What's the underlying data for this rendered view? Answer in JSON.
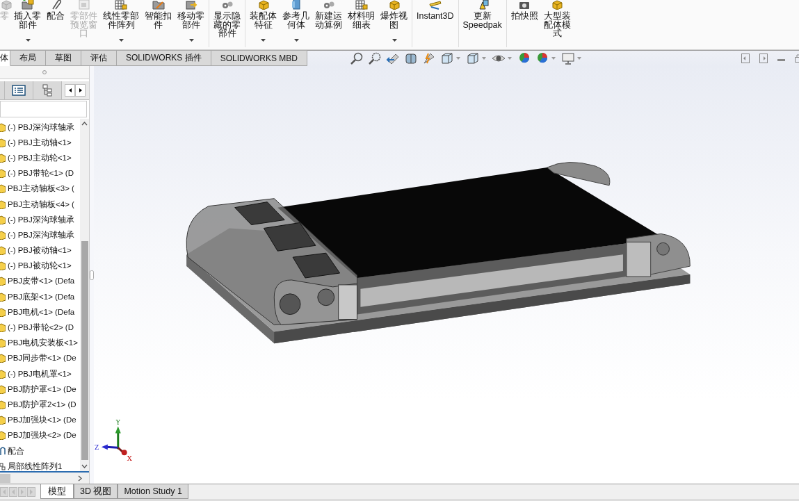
{
  "command_manager": {
    "buttons": [
      {
        "lines": [
          "零"
        ],
        "disabled": true,
        "dropdown": false,
        "kind": "part"
      },
      {
        "lines": [
          "插入零",
          "部件"
        ],
        "disabled": false,
        "dropdown": true,
        "kind": "insert"
      },
      {
        "lines": [
          "配合"
        ],
        "disabled": false,
        "dropdown": false,
        "kind": "clip"
      },
      {
        "lines": [
          "零部件",
          "预览窗",
          "口"
        ],
        "disabled": true,
        "dropdown": false,
        "kind": "window"
      },
      {
        "lines": [
          "线性零部",
          "件阵列"
        ],
        "disabled": false,
        "dropdown": true,
        "kind": "grid"
      },
      {
        "lines": [
          "智能扣",
          "件"
        ],
        "disabled": false,
        "dropdown": false,
        "kind": "folder"
      },
      {
        "lines": [
          "移动零",
          "部件"
        ],
        "disabled": false,
        "dropdown": true,
        "kind": "move"
      },
      {
        "lines": [
          "显示隐",
          "藏的零",
          "部件"
        ],
        "disabled": false,
        "dropdown": false,
        "kind": "gears",
        "separator_before": true
      },
      {
        "lines": [
          "装配体",
          "特征"
        ],
        "disabled": false,
        "dropdown": true,
        "kind": "part",
        "separator_before": true
      },
      {
        "lines": [
          "参考几",
          "何体"
        ],
        "disabled": false,
        "dropdown": true,
        "kind": "plane"
      },
      {
        "lines": [
          "新建运",
          "动算例"
        ],
        "disabled": false,
        "dropdown": false,
        "kind": "gears"
      },
      {
        "lines": [
          "材料明",
          "细表"
        ],
        "disabled": false,
        "dropdown": false,
        "kind": "grid"
      },
      {
        "lines": [
          "爆炸视",
          "图"
        ],
        "disabled": false,
        "dropdown": true,
        "kind": "part"
      },
      {
        "lines": [
          "Instant3D"
        ],
        "disabled": false,
        "dropdown": false,
        "kind": "ruler",
        "separator_before": true
      },
      {
        "lines": [
          "更新",
          "Speedpak"
        ],
        "disabled": false,
        "dropdown": false,
        "kind": "warning",
        "separator_before": true
      },
      {
        "lines": [
          "拍快照"
        ],
        "disabled": false,
        "dropdown": false,
        "kind": "camera",
        "separator_before": true
      },
      {
        "lines": [
          "大型装",
          "配体模",
          "式"
        ],
        "disabled": false,
        "dropdown": false,
        "kind": "part"
      }
    ]
  },
  "tabs": [
    {
      "label": "体",
      "selected": true
    },
    {
      "label": "布局",
      "selected": false
    },
    {
      "label": "草图",
      "selected": false
    },
    {
      "label": "评估",
      "selected": false
    },
    {
      "label": "SOLIDWORKS 插件",
      "selected": false
    },
    {
      "label": "SOLIDWORKS MBD",
      "selected": false
    }
  ],
  "view_toolbar": [
    {
      "kind": "zoom-fit",
      "dropdown": false
    },
    {
      "kind": "zoom-area",
      "dropdown": false
    },
    {
      "kind": "previous",
      "dropdown": false
    },
    {
      "kind": "section",
      "dropdown": false
    },
    {
      "kind": "dynamic",
      "dropdown": false
    },
    {
      "kind": "orientation",
      "dropdown": true
    },
    {
      "kind": "display",
      "dropdown": true
    },
    {
      "kind": "hide",
      "dropdown": true
    },
    {
      "kind": "appearance",
      "dropdown": false
    },
    {
      "kind": "scene",
      "dropdown": true
    },
    {
      "kind": "monitor",
      "dropdown": true
    }
  ],
  "tree": {
    "items": [
      {
        "kind": "part",
        "label": "(-) PBJ深沟球轴承"
      },
      {
        "kind": "part",
        "label": "(-) PBJ主动轴<1>"
      },
      {
        "kind": "part",
        "label": "(-) PBJ主动轮<1>"
      },
      {
        "kind": "part",
        "label": "(-) PBJ带轮<1> (D"
      },
      {
        "kind": "part",
        "label": "PBJ主动轴板<3> ("
      },
      {
        "kind": "part",
        "label": "PBJ主动轴板<4> ("
      },
      {
        "kind": "part",
        "label": "(-) PBJ深沟球轴承"
      },
      {
        "kind": "part",
        "label": "(-) PBJ深沟球轴承"
      },
      {
        "kind": "part",
        "label": "(-) PBJ被动轴<1>"
      },
      {
        "kind": "part",
        "label": "(-) PBJ被动轮<1>"
      },
      {
        "kind": "part",
        "label": "PBJ皮带<1> (Defa"
      },
      {
        "kind": "part",
        "label": "PBJ底架<1> (Defa"
      },
      {
        "kind": "part",
        "label": "PBJ电机<1> (Defa"
      },
      {
        "kind": "part",
        "label": "(-) PBJ带轮<2> (D"
      },
      {
        "kind": "part",
        "label": "PBJ电机安装板<1>"
      },
      {
        "kind": "part",
        "label": "PBJ同步带<1> (De"
      },
      {
        "kind": "part",
        "label": "(-) PBJ电机罩<1>"
      },
      {
        "kind": "part",
        "label": "PBJ防护罩<1> (De"
      },
      {
        "kind": "part",
        "label": "PBJ防护罩2<1> (D"
      },
      {
        "kind": "part",
        "label": "PBJ加强块<1> (De"
      },
      {
        "kind": "part",
        "label": "PBJ加强块<2> (De"
      },
      {
        "kind": "mates",
        "label": "配合"
      },
      {
        "kind": "pattern",
        "label": "局部线性阵列1"
      }
    ]
  },
  "triad": {
    "x": "X",
    "y": "Y",
    "z": "Z"
  },
  "bottom_tabs": [
    {
      "label": "模型",
      "selected": true
    },
    {
      "label": "3D 视图",
      "selected": false
    },
    {
      "label": "Motion Study 1",
      "selected": false
    }
  ]
}
